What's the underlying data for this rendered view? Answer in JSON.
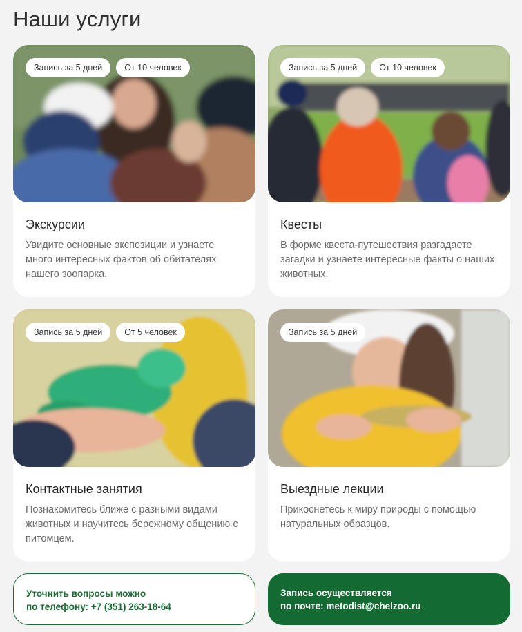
{
  "page": {
    "title": "Наши услуги"
  },
  "cards": [
    {
      "title": "Экскурсии",
      "badges": [
        "Запись за 5 дней",
        "От 10 человек"
      ],
      "description": "Увидите основные экспозиции и узнаете много интересных фактов об обитателях нашего зоопарка."
    },
    {
      "title": "Квесты",
      "badges": [
        "Запись за 5 дней",
        "От 10 человек"
      ],
      "description": "В форме квеста-путешествия разгадаете загадки и узнаете интересные факты о наших животных."
    },
    {
      "title": "Контактные занятия",
      "badges": [
        "Запись за 5 дней",
        "От 5 человек"
      ],
      "description": "Познакомитесь ближе с разными видами животных и научитесь бережному общению с питомцем."
    },
    {
      "title": "Выездные лекции",
      "badges": [
        "Запись за 5 дней"
      ],
      "description": "Прикоснетесь к миру природы с помощью натуральных образцов."
    }
  ],
  "contacts": {
    "phone": {
      "line1": "Уточнить вопросы можно",
      "line2": "по телефону: +7 (351) 263-18-64"
    },
    "email": {
      "line1": "Запись осуществляется",
      "line2": "по почте: metodist@chelzoo.ru"
    }
  },
  "colors": {
    "accent": "#146b32",
    "background": "#f3f3f3",
    "card": "#ffffff"
  }
}
